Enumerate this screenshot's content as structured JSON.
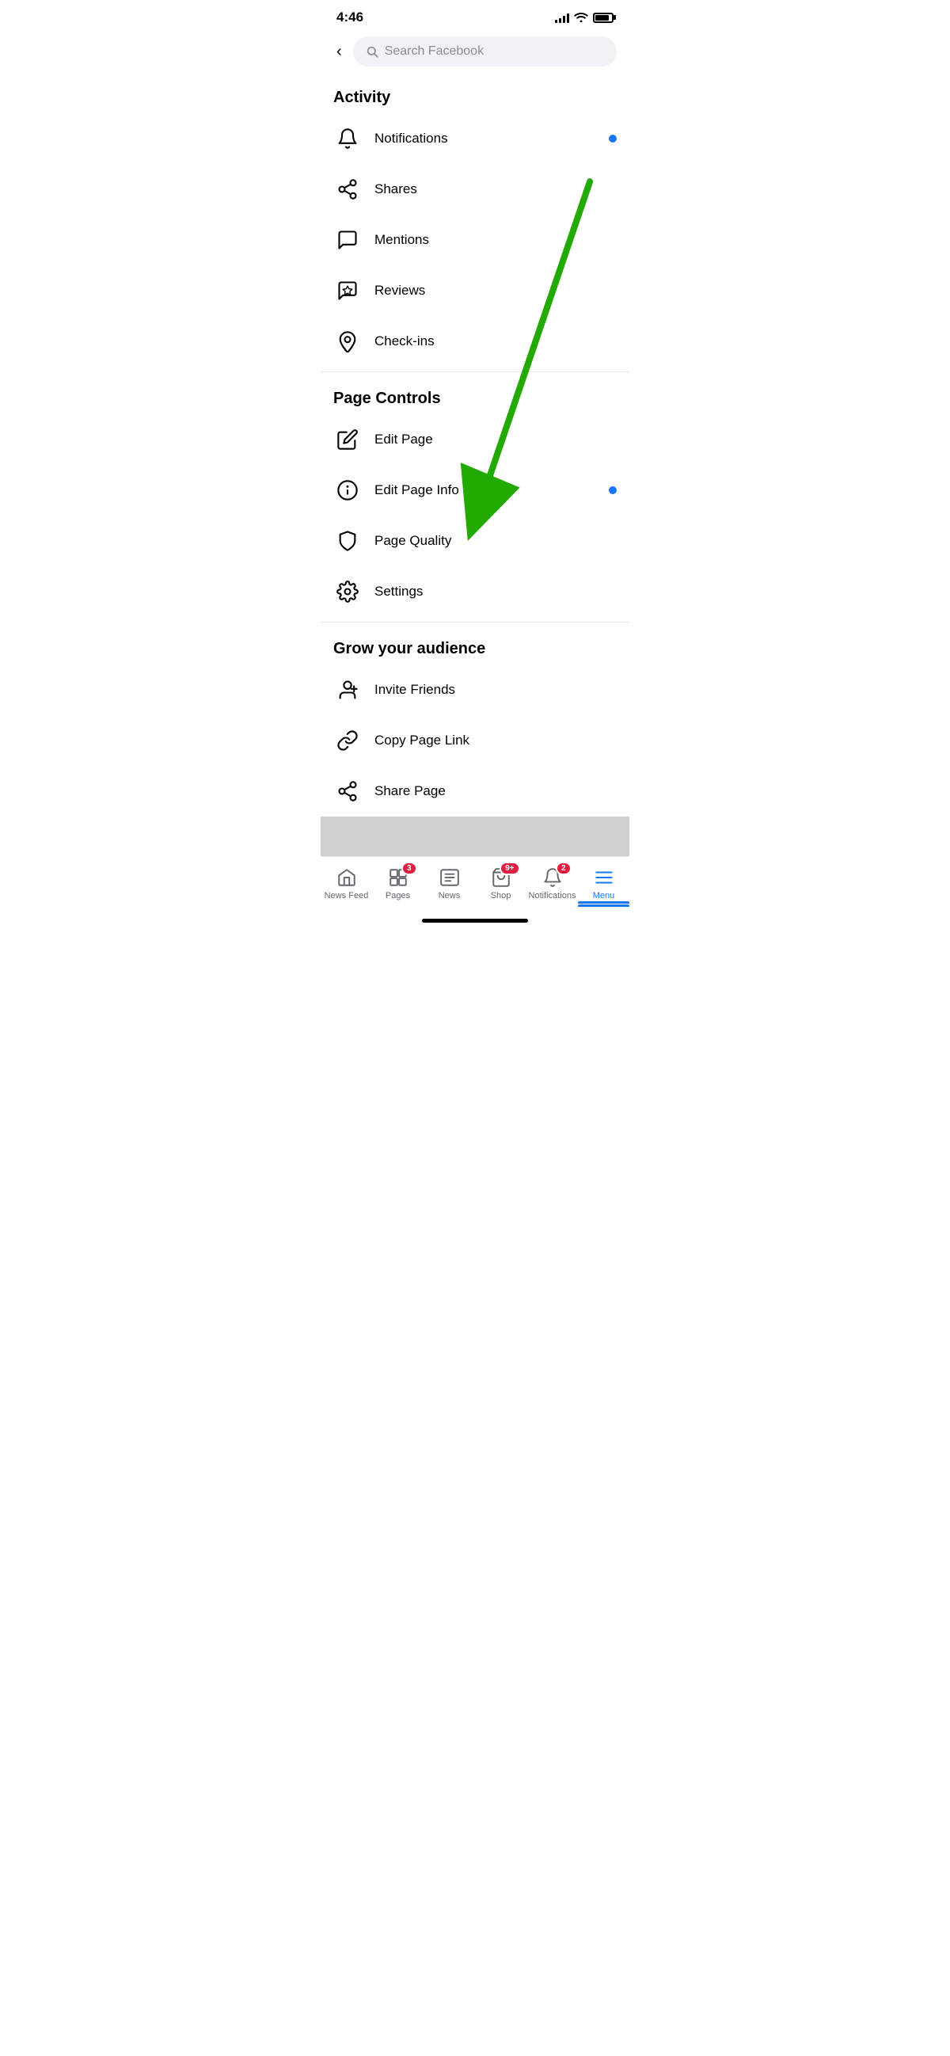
{
  "statusBar": {
    "time": "4:46",
    "signal": [
      3,
      5,
      7,
      9,
      11
    ],
    "wifi": true,
    "battery": 85
  },
  "searchBar": {
    "backLabel": "‹",
    "placeholder": "Search Facebook"
  },
  "sections": [
    {
      "id": "activity",
      "header": "Activity",
      "items": [
        {
          "id": "notifications",
          "label": "Notifications",
          "icon": "bell",
          "dot": true
        },
        {
          "id": "shares",
          "label": "Shares",
          "icon": "share",
          "dot": false
        },
        {
          "id": "mentions",
          "label": "Mentions",
          "icon": "comment",
          "dot": false
        },
        {
          "id": "reviews",
          "label": "Reviews",
          "icon": "star-comment",
          "dot": false
        },
        {
          "id": "checkins",
          "label": "Check-ins",
          "icon": "location",
          "dot": false
        }
      ]
    },
    {
      "id": "page-controls",
      "header": "Page Controls",
      "items": [
        {
          "id": "edit-page",
          "label": "Edit Page",
          "icon": "pencil",
          "dot": false
        },
        {
          "id": "edit-page-info",
          "label": "Edit Page Info",
          "icon": "info-circle",
          "dot": true
        },
        {
          "id": "page-quality",
          "label": "Page Quality",
          "icon": "shield",
          "dot": false
        },
        {
          "id": "settings",
          "label": "Settings",
          "icon": "gear",
          "dot": false
        }
      ]
    },
    {
      "id": "grow-audience",
      "header": "Grow your audience",
      "items": [
        {
          "id": "invite-friends",
          "label": "Invite Friends",
          "icon": "person-plus",
          "dot": false
        },
        {
          "id": "copy-page-link",
          "label": "Copy Page Link",
          "icon": "link",
          "dot": false
        },
        {
          "id": "share-page",
          "label": "Share Page",
          "icon": "share-arrow",
          "dot": false
        }
      ]
    }
  ],
  "bottomNav": [
    {
      "id": "news-feed",
      "label": "News Feed",
      "icon": "home",
      "badge": null,
      "active": false
    },
    {
      "id": "pages",
      "label": "Pages",
      "icon": "pages",
      "badge": "3",
      "active": false
    },
    {
      "id": "news",
      "label": "News",
      "icon": "news",
      "badge": null,
      "active": false
    },
    {
      "id": "shop",
      "label": "Shop",
      "icon": "shop",
      "badge": "9+",
      "active": false
    },
    {
      "id": "notifications-nav",
      "label": "Notifications",
      "icon": "bell-nav",
      "badge": "2",
      "active": false
    },
    {
      "id": "menu",
      "label": "Menu",
      "icon": "menu",
      "badge": null,
      "active": true
    }
  ]
}
